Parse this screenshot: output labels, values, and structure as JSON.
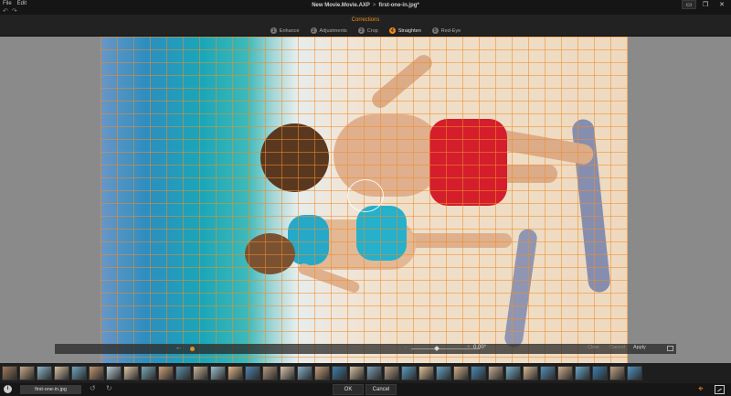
{
  "menu": {
    "file": "File",
    "edit": "Edit"
  },
  "undo": {
    "undo": "↶",
    "redo": "↷"
  },
  "breadcrumb": {
    "project": "New Movie.Movie.AXP",
    "separator": ">",
    "file": "first-one-in.jpg*"
  },
  "window": {
    "store_icon": "store-icon",
    "restore": "❐",
    "close": "✕"
  },
  "corrections": {
    "title": "Corrections",
    "tabs": [
      {
        "num": "1",
        "label": "Enhance"
      },
      {
        "num": "2",
        "label": "Adjustments"
      },
      {
        "num": "3",
        "label": "Crop"
      },
      {
        "num": "4",
        "label": "Straighten"
      },
      {
        "num": "5",
        "label": "Red-Eye"
      }
    ],
    "active_tab": "Straighten"
  },
  "straighten_bar": {
    "back_arrow": "←",
    "min_label": "-",
    "max_label": "+",
    "angle_value": "0.00°",
    "clear": "Clear",
    "cancel": "Cancel",
    "apply": "Apply"
  },
  "bottom": {
    "info": "i",
    "filename": "first-one-in.jpg",
    "rotate_left": "↺",
    "rotate_right": "↻",
    "ok": "OK",
    "cancel": "Cancel",
    "target": "⌖"
  },
  "colors": {
    "accent": "#f08a1c",
    "background": "#1a1a1a"
  }
}
